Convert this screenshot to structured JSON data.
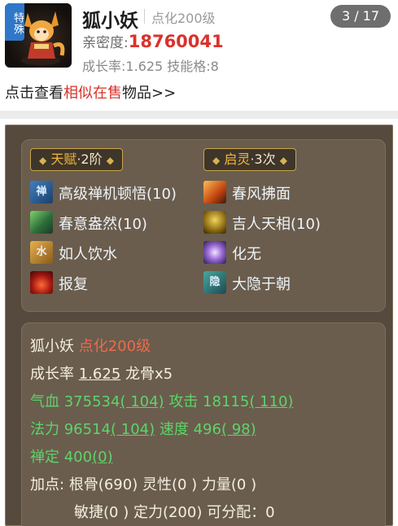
{
  "header": {
    "badge": "特殊",
    "pet_name": "狐小妖",
    "refine_level": "点化200级",
    "counter": "3 / 17",
    "intimacy_label": "亲密度:",
    "intimacy_value": "18760041",
    "growth_info": "成长率:1.625  技能格:8",
    "similar_prefix": "点击查看",
    "similar_link": "相似在售",
    "similar_suffix": "物品>>"
  },
  "talent": {
    "label": "天赋",
    "level": "·2阶"
  },
  "qiling": {
    "label": "启灵",
    "count": "·3次"
  },
  "skills": [
    {
      "name": "高级禅机顿悟(10)",
      "icon": "chanji-icon"
    },
    {
      "name": "春风拂面",
      "icon": "spring-breeze-icon"
    },
    {
      "name": "春意盎然(10)",
      "icon": "spring-icon"
    },
    {
      "name": "吉人天相(10)",
      "icon": "lucky-icon"
    },
    {
      "name": "如人饮水",
      "icon": "water-icon"
    },
    {
      "name": "化无",
      "icon": "vanish-icon"
    },
    {
      "name": "报复",
      "icon": "revenge-icon"
    },
    {
      "name": "大隐于朝",
      "icon": "hermit-icon"
    }
  ],
  "stats": {
    "name": "狐小妖",
    "refine": "点化200级",
    "growth_label": "成长率",
    "growth_value": "1.625",
    "dragon_bone": "龙骨x5",
    "hp_label": "气血",
    "hp_value": "375534",
    "hp_bonus": "( 104)",
    "atk_label": "攻击",
    "atk_value": "18115",
    "atk_bonus": "( 110)",
    "mp_label": "法力",
    "mp_value": "96514",
    "mp_bonus": "( 104)",
    "spd_label": "速度",
    "spd_value": "496",
    "spd_bonus": "( 98)",
    "zen_label": "禅定",
    "zen_value": "400",
    "zen_bonus": "(0)",
    "points_label": "加点:",
    "gengu": "根骨(690)",
    "lingxing": "灵性(0 )",
    "liliang": "力量(0 )",
    "minjie": "敏捷(0 )",
    "dingli": "定力(200)",
    "assignable": "可分配：0"
  }
}
